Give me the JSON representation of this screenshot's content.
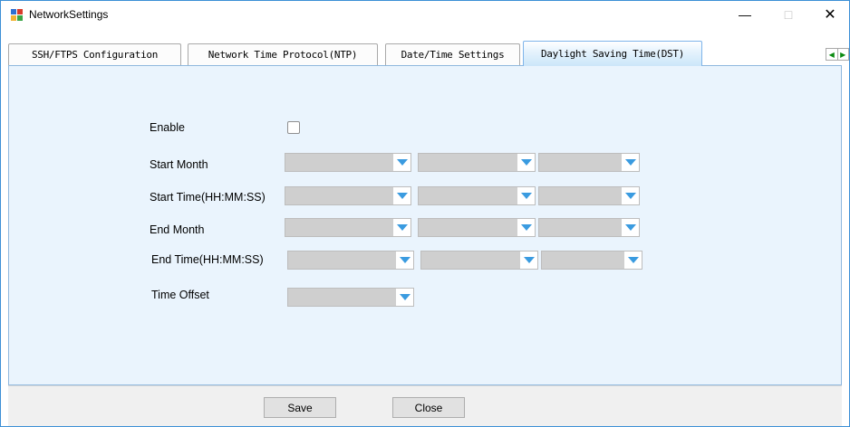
{
  "window": {
    "title": "NetworkSettings"
  },
  "tabs": [
    {
      "label": "SSH/FTPS Configuration"
    },
    {
      "label": "Network Time Protocol(NTP)"
    },
    {
      "label": "Date/Time Settings"
    },
    {
      "label": "Daylight Saving Time(DST)"
    }
  ],
  "active_tab": "Daylight Saving Time(DST)",
  "form": {
    "enable_label": "Enable",
    "enable_checked": false,
    "start_month_label": "Start Month",
    "start_time_label": "Start Time(HH:MM:SS)",
    "end_month_label": "End Month",
    "end_time_label": "End Time(HH:MM:SS)",
    "time_offset_label": "Time Offset",
    "start_month_values": [
      "",
      "",
      ""
    ],
    "start_time_values": [
      "",
      "",
      ""
    ],
    "end_month_values": [
      "",
      "",
      ""
    ],
    "end_time_values": [
      "",
      "",
      ""
    ],
    "time_offset_value": ""
  },
  "buttons": {
    "save": "Save",
    "close": "Close"
  },
  "colors": {
    "accent": "#3a9be0",
    "panel": "#eaf4fd",
    "combo": "#cfcfcf"
  }
}
